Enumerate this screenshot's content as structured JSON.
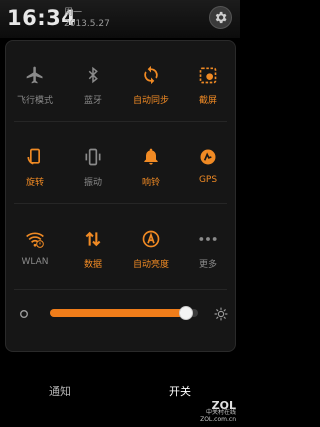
{
  "header": {
    "time": "16:34",
    "weekday": "周一",
    "date": "2013.5.27"
  },
  "toggles": [
    {
      "label": "飞行模式",
      "icon": "airplane-icon",
      "active": false
    },
    {
      "label": "蓝牙",
      "icon": "bluetooth-icon",
      "active": false
    },
    {
      "label": "自动同步",
      "icon": "sync-icon",
      "active": true
    },
    {
      "label": "截屏",
      "icon": "screenshot-icon",
      "active": true
    },
    {
      "label": "旋转",
      "icon": "rotate-icon",
      "active": true
    },
    {
      "label": "振动",
      "icon": "vibrate-icon",
      "active": false
    },
    {
      "label": "响铃",
      "icon": "bell-icon",
      "active": true
    },
    {
      "label": "GPS",
      "icon": "gps-icon",
      "active": true
    },
    {
      "label": "WLAN",
      "icon": "wifi-icon",
      "active": false
    },
    {
      "label": "数据",
      "icon": "data-icon",
      "active": true
    },
    {
      "label": "自动亮度",
      "icon": "auto-brightness-icon",
      "active": true
    },
    {
      "label": "更多",
      "icon": "more-icon",
      "active": false
    }
  ],
  "brightness": {
    "level": 0.96
  },
  "tabs": {
    "notifications": "通知",
    "switches": "开关"
  },
  "watermark": {
    "logo": "ZOL",
    "line1": "中关村在线",
    "line2": "ZOL.com.cn"
  },
  "colors": {
    "accent": "#f08a24",
    "inactive": "#8a8a8a"
  }
}
